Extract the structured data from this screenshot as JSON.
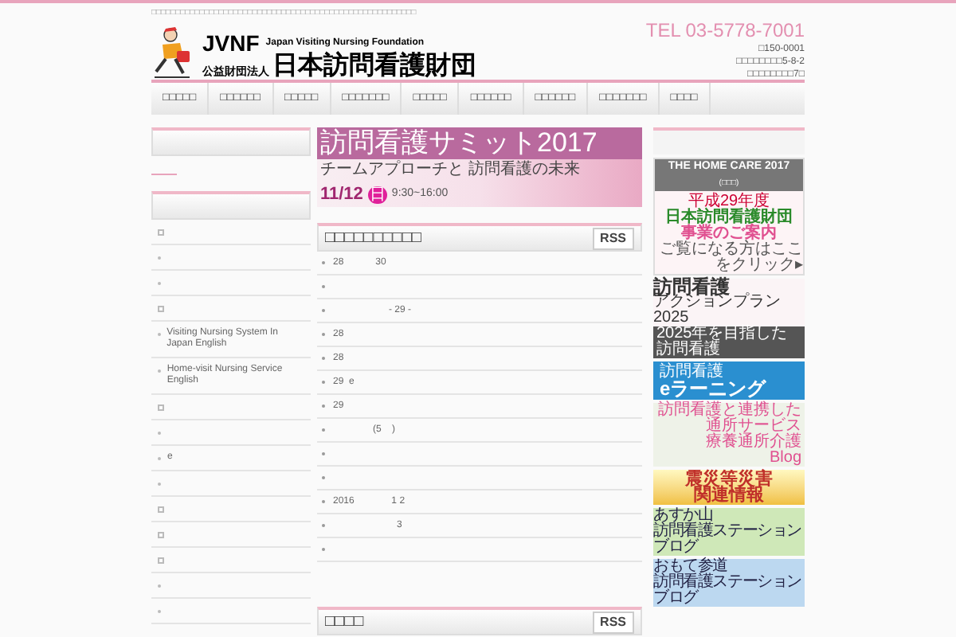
{
  "top_line": "□□□□□□□□□□□□□□□□□□□□□□□□□□□□□□□□□□□□□□□□□□□□□□□□□□□□□□□",
  "logo": {
    "abbr": "JVNF",
    "english": "Japan Visiting Nursing Foundation",
    "type": "公益財団法人",
    "name": "日本訪問看護財団"
  },
  "contact": {
    "tel": "TEL 03-5778-7001",
    "address": [
      "□150-0001",
      "□□□□□□□□5-8-2",
      "□□□□□□□□7□"
    ]
  },
  "nav": [
    "□□□□□",
    "□□□□□□",
    "□□□□□",
    "□□□□□□□",
    "□□□□□",
    "□□□□□□",
    "□□□□□□",
    "□□□□□□□",
    "□□□□"
  ],
  "sidebar": {
    "items": [
      {
        "kind": "square"
      },
      {
        "kind": "dot"
      },
      {
        "kind": "dot"
      },
      {
        "kind": "square"
      },
      {
        "kind": "dot",
        "text": "Visiting Nursing System In Japan English"
      },
      {
        "kind": "dot",
        "text": "Home-visit Nursing Service English"
      },
      {
        "kind": "square"
      },
      {
        "kind": "dot"
      },
      {
        "kind": "dot",
        "text": "e"
      },
      {
        "kind": "dot"
      },
      {
        "kind": "square"
      },
      {
        "kind": "square"
      },
      {
        "kind": "square"
      },
      {
        "kind": "dot"
      },
      {
        "kind": "dot"
      }
    ]
  },
  "summit_banner": {
    "title": "訪問看護サミット2017",
    "subtitle": "チームアプローチと 訪問看護の未来",
    "date": "11/12",
    "weekday": "日",
    "time": "9:30~16:00"
  },
  "news": {
    "title": "□□□□□□□□□□",
    "rss": "RSS",
    "rows": [
      {
        "text": "28            30"
      },
      {},
      {
        "text": "                     - 29 -"
      },
      {
        "text": "28"
      },
      {
        "text": "28"
      },
      {
        "text": "29  e"
      },
      {
        "text": "29"
      },
      {
        "text": "               (5    )"
      },
      {},
      {},
      {
        "text": "2016              1 2"
      },
      {
        "text": "                        3"
      },
      {}
    ]
  },
  "second_box": {
    "title": "□□□□",
    "rss": "RSS"
  },
  "right_banners": {
    "home_care": {
      "title": "THE HOME CARE 2017",
      "sub": "(□□□)",
      "year": "平成29年度",
      "org": "日本訪問看護財団",
      "guide": "事業のご案内",
      "click": "ご覧になる方はここをクリック▸"
    },
    "action_plan": {
      "title": "訪問看護",
      "plan": "アクションプラン 2025",
      "sub": "2025年を目指した訪問看護"
    },
    "elearning": {
      "small": "訪問看護",
      "big": "eラーニング"
    },
    "daycare": {
      "top": "訪問看護と連携した通所サービス",
      "name": "療養通所介護",
      "blog": "Blog"
    },
    "disaster": {
      "line1": "震災等災害",
      "line2": "関連情報"
    },
    "stations": [
      {
        "lines": [
          "あすか山",
          "訪問看護ステーション",
          "ブログ"
        ]
      },
      {
        "lines": [
          "おもて参道",
          "訪問看護ステーション",
          "ブログ"
        ]
      }
    ]
  }
}
